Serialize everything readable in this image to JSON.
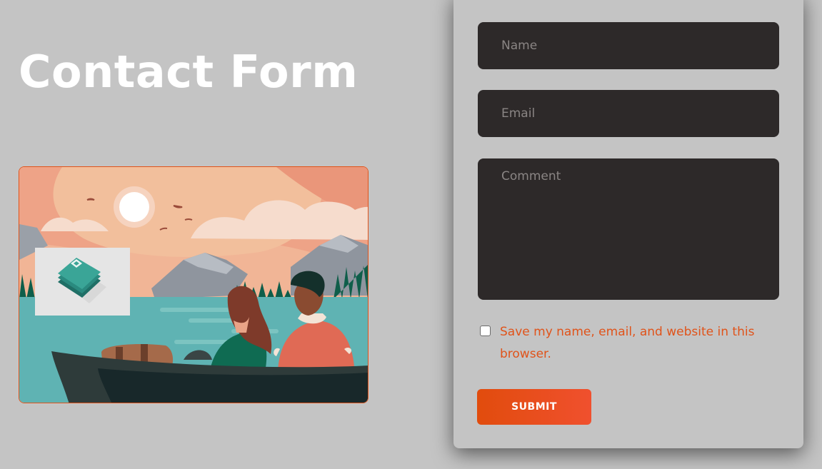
{
  "page": {
    "title": "Contact Form"
  },
  "form": {
    "name_placeholder": "Name",
    "email_placeholder": "Email",
    "comment_placeholder": "Comment",
    "save_info_label": "Save my name, email, and website in this browser.",
    "save_info_checked": false,
    "submit_label": "SUBMIT"
  },
  "illustration": {
    "scene": "couple-in-boat-lake-sunset",
    "overlay_icon": "stacked-shirts-icon"
  },
  "colors": {
    "background": "#c4c4c4",
    "field_bg": "#2d2929",
    "accent": "#e0531a",
    "button_start": "#e14c0d",
    "button_end": "#f0502e"
  }
}
